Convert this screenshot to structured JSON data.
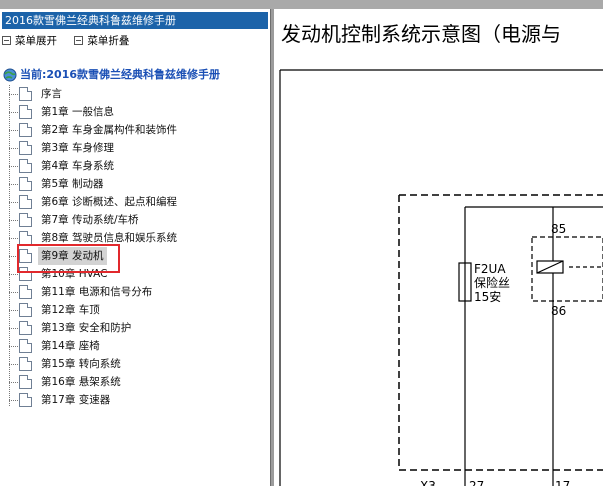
{
  "sidebar": {
    "title": "2016款雪佛兰经典科鲁兹维修手册",
    "menu": {
      "expand_label": "菜单展开",
      "collapse_label": "菜单折叠"
    },
    "root_label": "当前:2016款雪佛兰经典科鲁兹维修手册",
    "items": [
      {
        "label": "序言"
      },
      {
        "label": "第1章 一般信息"
      },
      {
        "label": "第2章 车身金属构件和装饰件"
      },
      {
        "label": "第3章 车身修理"
      },
      {
        "label": "第4章 车身系统"
      },
      {
        "label": "第5章 制动器"
      },
      {
        "label": "第6章 诊断概述、起点和编程"
      },
      {
        "label": "第7章 传动系统/车桥"
      },
      {
        "label": "第8章 驾驶员信息和娱乐系统"
      },
      {
        "label": "第9章 发动机"
      },
      {
        "label": "第10章 HVAC"
      },
      {
        "label": "第11章 电源和信号分布"
      },
      {
        "label": "第12章 车顶"
      },
      {
        "label": "第13章 安全和防护"
      },
      {
        "label": "第14章 座椅"
      },
      {
        "label": "第15章 转向系统"
      },
      {
        "label": "第16章 悬架系统"
      },
      {
        "label": "第17章 变速器"
      }
    ],
    "selected_index": 9
  },
  "content": {
    "title": "发动机控制系统示意图（电源与",
    "diagram": {
      "fuse_code": "F2UA",
      "fuse_name": "保险丝",
      "fuse_rating": "15安",
      "relay_pin_top": "85",
      "relay_pin_bottom": "86",
      "connector": "X3",
      "pin_left": "27",
      "pin_right": "17"
    }
  },
  "colors": {
    "title_bar": "#1c63a9",
    "root_label": "#1a4fb5",
    "highlight_box": "#e1282c",
    "selected_bg": "#d3d3d3"
  }
}
